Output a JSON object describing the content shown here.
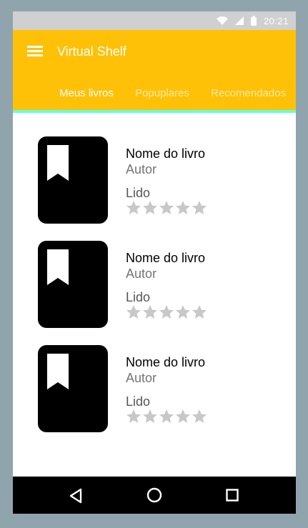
{
  "status_bar": {
    "time": "20:21",
    "icons": [
      "wifi-icon",
      "cell-signal-icon",
      "battery-icon"
    ]
  },
  "app_bar": {
    "title": "Virtual Shelf",
    "menu_icon": "hamburger-menu-icon",
    "background_color": "#ffc107",
    "indicator_color": "#64ffda"
  },
  "tabs": [
    {
      "label": "Meus livros",
      "active": true
    },
    {
      "label": "Popuplares",
      "active": false
    },
    {
      "label": "Recomendados",
      "active": false
    }
  ],
  "books": [
    {
      "title": "Nome do livro",
      "author": "Autor",
      "status": "Lido",
      "rating": 0,
      "max_rating": 5,
      "cover_icon": "bookmark-icon"
    },
    {
      "title": "Nome do livro",
      "author": "Autor",
      "status": "Lido",
      "rating": 0,
      "max_rating": 5,
      "cover_icon": "bookmark-icon"
    },
    {
      "title": "Nome do livro",
      "author": "Autor",
      "status": "Lido",
      "rating": 0,
      "max_rating": 5,
      "cover_icon": "bookmark-icon"
    }
  ],
  "nav_bar": {
    "buttons": [
      "back-triangle-icon",
      "home-circle-icon",
      "recents-square-icon"
    ]
  }
}
